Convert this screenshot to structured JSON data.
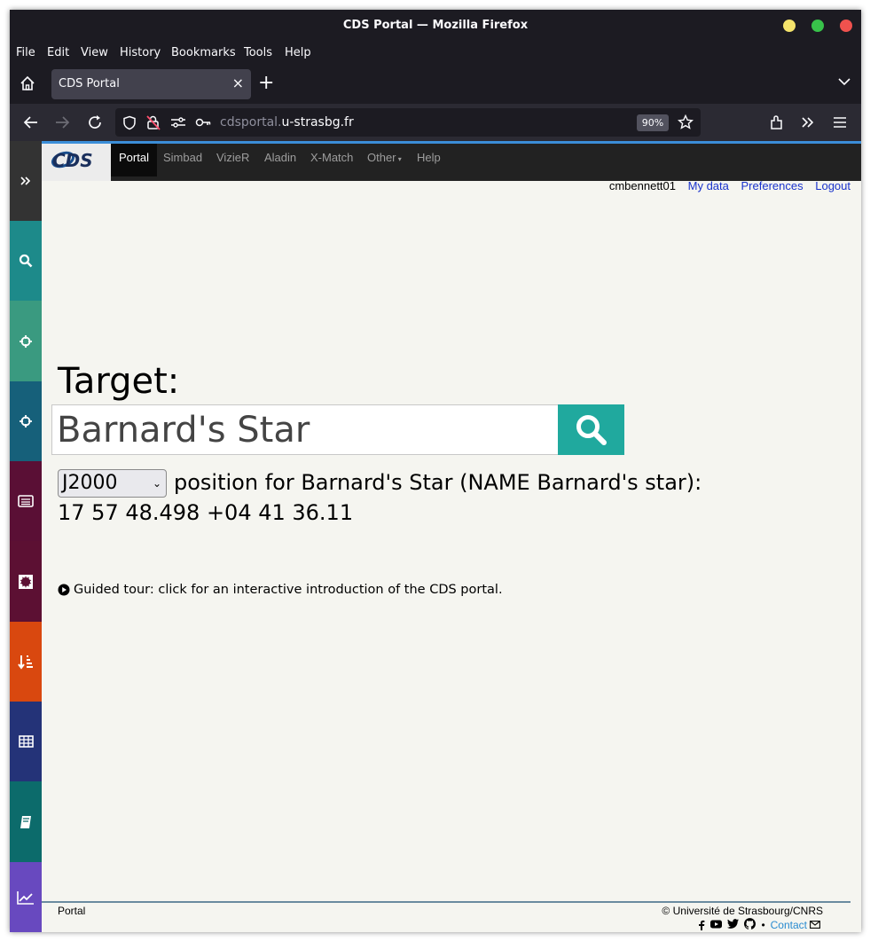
{
  "window": {
    "title": "CDS Portal — Mozilla Firefox"
  },
  "menu": [
    "File",
    "Edit",
    "View",
    "History",
    "Bookmarks",
    "Tools",
    "Help"
  ],
  "tab": {
    "label": "CDS Portal"
  },
  "url": {
    "domain_dim": "cdsportal.",
    "domain_main": "u-strasbg.fr",
    "zoom": "90%"
  },
  "cds_nav": {
    "logo": "CDS",
    "items": [
      "Portal",
      "Simbad",
      "VizieR",
      "Aladin",
      "X-Match",
      "Other",
      "Help"
    ]
  },
  "user": {
    "name": "cmbennett01",
    "my_data": "My data",
    "preferences": "Preferences",
    "logout": "Logout"
  },
  "search": {
    "label": "Target:",
    "value": "Barnard's Star",
    "frame": "J2000",
    "position_text": "position for Barnard's Star (NAME Barnard's star):",
    "coords": "17 57 48.498 +04 41 36.11"
  },
  "tour": {
    "text": "Guided tour: click for an interactive introduction of the CDS portal."
  },
  "footer": {
    "left": "Portal",
    "copyright": "© Université de Strasbourg/CNRS",
    "contact": "Contact"
  },
  "sidebar_colors": [
    "#333333",
    "#1d8a8a",
    "#3a9a80",
    "#16607a",
    "#5a0f35",
    "#5c1033",
    "#d9480f",
    "#243378",
    "#0c6b6b",
    "#6849bf"
  ]
}
